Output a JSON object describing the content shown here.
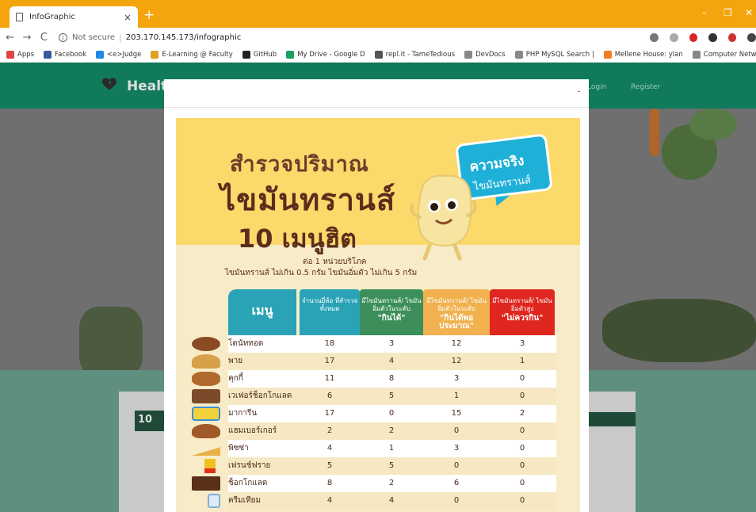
{
  "browser": {
    "tab_title": "InfoGraphic",
    "tab_close": "×",
    "new_tab": "+",
    "security": "Not secure",
    "url": "203.170.145.173/infographic",
    "minimize": "–",
    "maximize": "❐",
    "close": "✕",
    "back": "←",
    "forward": "→",
    "reload": "C"
  },
  "bookmarks": [
    {
      "label": "Apps",
      "color": "#d44"
    },
    {
      "label": "Facebook",
      "color": "#3b5998"
    },
    {
      "label": "<e>Judge",
      "color": "#1e88e5"
    },
    {
      "label": "E-Learning @ Faculty",
      "color": "#e0a020"
    },
    {
      "label": "GitHub",
      "color": "#222"
    },
    {
      "label": "My Drive - Google D",
      "color": "#1aa260"
    },
    {
      "label": "repl.it - TameTedious",
      "color": "#555"
    },
    {
      "label": "DevDocs",
      "color": "#888"
    },
    {
      "label": "PHP MySQL Search |",
      "color": "#888"
    },
    {
      "label": "Mellene House: ylan",
      "color": "#f47b20"
    },
    {
      "label": "Computer Networks",
      "color": "#888"
    }
  ],
  "site": {
    "brand": "Healt",
    "login": "Login",
    "register": "Register",
    "card_left_heading": "10",
    "modal_close": "–"
  },
  "infographic": {
    "title_line1": "สำรวจปริมาณ",
    "title_line2": "ไขมันทรานส์",
    "title_line3": "10 เมนูฮิต",
    "sub1": "ต่อ 1 หน่วยบริโภค",
    "sub2": "ไขมันทรานส์ ไม่เกิน 0.5 กรัม ไขมันอิ่มตัว ไม่เกิน 5 กรัม",
    "bubble_line1": "ความจริง",
    "bubble_line2": "ไขมันทรานส์",
    "headers": {
      "menu": "เมนู",
      "total": "จำนวนยี่ห้อ ที่สำรวจ ทั้งหมด",
      "c2_top": "มีไขมันทรานส์/ ไขมันอิ่มตัวในระดับ",
      "c2_em": "\"กินได้\"",
      "c3_top": "มีไขมันทรานส์/ ไขมันอิ่มตัวในระดับ",
      "c3_em": "\"กินได้พอประมาณ\"",
      "c4_top": "มีไขมันทรานส์/ ไขมันอิ่มตัวสูง",
      "c4_em": "\"ไม่ควรกิน\""
    },
    "rows": [
      {
        "name": "โดนัททอด",
        "total": "18",
        "ok": "3",
        "moderate": "12",
        "avoid": "3"
      },
      {
        "name": "พาย",
        "total": "17",
        "ok": "4",
        "moderate": "12",
        "avoid": "1"
      },
      {
        "name": "คุกกี้",
        "total": "11",
        "ok": "8",
        "moderate": "3",
        "avoid": "0"
      },
      {
        "name": "เวเฟอร์ช็อกโกแลต",
        "total": "6",
        "ok": "5",
        "moderate": "1",
        "avoid": "0"
      },
      {
        "name": "มาการีน",
        "total": "17",
        "ok": "0",
        "moderate": "15",
        "avoid": "2"
      },
      {
        "name": "แฮมเบอร์เกอร์",
        "total": "2",
        "ok": "2",
        "moderate": "0",
        "avoid": "0"
      },
      {
        "name": "พิซซ่า",
        "total": "4",
        "ok": "1",
        "moderate": "3",
        "avoid": "0"
      },
      {
        "name": "เฟรนช์ฟราย",
        "total": "5",
        "ok": "5",
        "moderate": "0",
        "avoid": "0"
      },
      {
        "name": "ช็อกโกแลต",
        "total": "8",
        "ok": "2",
        "moderate": "6",
        "avoid": "0"
      },
      {
        "name": "ครีมเทียม",
        "total": "4",
        "ok": "4",
        "moderate": "0",
        "avoid": "0"
      }
    ],
    "food_colors": [
      "#8a4b22",
      "#d9a04a",
      "#b06a2c",
      "#7a4a2a",
      "#f2d23c",
      "#a05a28",
      "#e8b048",
      "#f0c020",
      "#5a3018",
      "#7fb0d8"
    ]
  }
}
